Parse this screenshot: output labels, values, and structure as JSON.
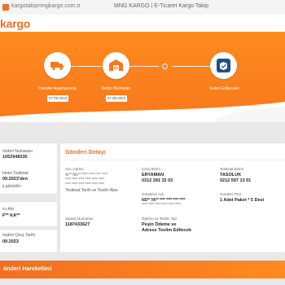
{
  "browser": {
    "url": "kargotakipmngkargo.com.tr",
    "title": "MNG KARGO | E-Ticaret Kargo Takip"
  },
  "logo": "kargo",
  "steps": [
    {
      "label": "Transfer Aşamasında",
      "date": "27.09.2023",
      "icon": "truck-icon"
    },
    {
      "label": "Teslim Biriminde",
      "date": "27.09.2023",
      "icon": "warehouse-icon"
    },
    {
      "label": "Teslim Edilecekti",
      "date": "",
      "icon": "delivered-box-icon"
    }
  ],
  "sidebar": {
    "tracking_label": "önderi Numarası",
    "tracking_value": "1052948335",
    "delivery_label": "hmini Teslimat",
    "delivery_value": "09.2023'den",
    "delivery_note": "ş günüdür",
    "recipient_label": "ıcı Adı",
    "recipient_value": "F** KA**",
    "sender_label": "önderi Çıkış Tarihi",
    "sender_value": "09.2023"
  },
  "detail": {
    "title": "Gönderi Detayı",
    "address_label": "Alıcı Adresi",
    "address_line1": "Ar** Me** **** **** **** ****",
    "address_line2": "**** **** **** **** **** ****",
    "address_line3": "**** **** **** **** **** ****",
    "address_line4": "Teslimat Tarihi ve Teslim Alan",
    "out_unit_label": "Çıkış Birimi",
    "out_unit_value": "ERYAMAN",
    "out_unit_phone": "0312 281 32 03",
    "sender_label": "Gönderici Adı",
    "sender_value": "NS** YA** **** **** **** ****",
    "sender_line2": "**** **** **** **** **** ****",
    "delivery_unit_label": "Teslimat Birimi",
    "delivery_unit_value": "TASOLUK",
    "delivery_unit_phone": "0212 597 13 01",
    "type_label": "Gönderi Türü",
    "type_value": "1 Adet Paket * 5 Desi",
    "order_label": "Sipariş Numarası",
    "order_value": "1187433627",
    "payment_label": "Ödeme ve Teslim Tipi",
    "payment_value1": "Peşin Ödeme ve",
    "payment_value2": "Adrese Teslim Edilecek"
  },
  "movements_title": "önderi Hareketleri",
  "colors": {
    "brand": "#f26f21",
    "hero": "#f7781c",
    "delivered_icon": "#1e4f86"
  }
}
